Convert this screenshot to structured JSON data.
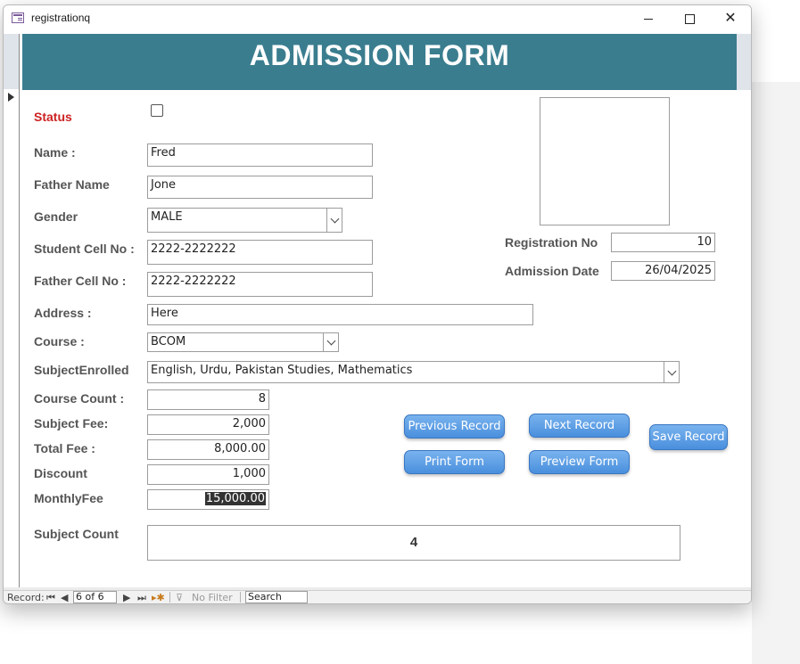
{
  "window": {
    "title": "registrationq"
  },
  "form": {
    "title": "ADMISSION FORM",
    "labels": {
      "status": "Status",
      "name": "Name :",
      "father_name": "Father Name",
      "gender": "Gender",
      "student_cell": "Student Cell No :",
      "father_cell": "Father Cell No :",
      "address": "Address :",
      "course": "Course :",
      "subject_enrolled": "SubjectEnrolled",
      "course_count": "Course Count :",
      "subject_fee": "Subject Fee:",
      "total_fee": "Total Fee :",
      "discount": "Discount",
      "monthly_fee": "MonthlyFee",
      "subject_count": "Subject Count",
      "registration_no": "Registration No",
      "admission_date": "Admission Date"
    },
    "values": {
      "status_checked": false,
      "name": "Fred",
      "father_name": "Jone",
      "gender": "MALE",
      "student_cell": "2222-2222222",
      "father_cell": "2222-2222222",
      "address": "Here",
      "course": "BCOM",
      "subject_enrolled": "English, Urdu, Pakistan Studies, Mathematics",
      "course_count": "8",
      "subject_fee": "2,000",
      "total_fee": "8,000.00",
      "discount": "1,000",
      "monthly_fee": "15,000.00",
      "subject_count": "4",
      "registration_no": "10",
      "admission_date": "26/04/2025"
    },
    "buttons": {
      "previous": "Previous Record",
      "next": "Next Record",
      "save": "Save Record",
      "print": "Print Form",
      "preview": "Preview Form"
    }
  },
  "navigation": {
    "record_label": "Record:",
    "record_position": "6 of 6",
    "no_filter": "No Filter",
    "search": "Search"
  },
  "colors": {
    "header": "#3a7d8f",
    "button": "#4a8fdd",
    "status_label": "#cc2222"
  }
}
